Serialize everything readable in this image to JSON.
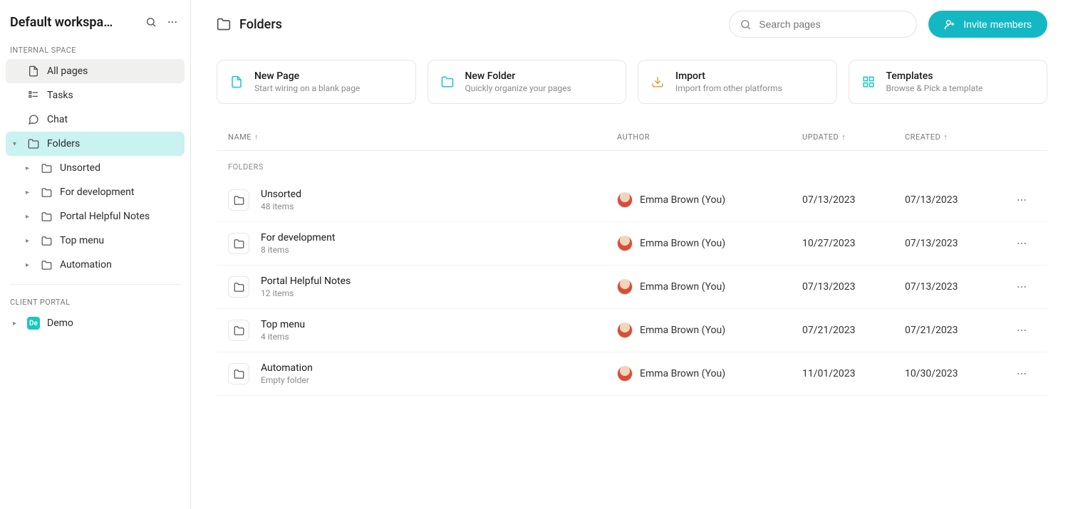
{
  "workspace": {
    "title": "Default workspa…"
  },
  "sidebar": {
    "sections": {
      "internal": {
        "label": "INTERNAL SPACE",
        "items": [
          {
            "label": "All pages"
          },
          {
            "label": "Tasks"
          },
          {
            "label": "Chat"
          },
          {
            "label": "Folders"
          }
        ],
        "folders": [
          {
            "label": "Unsorted"
          },
          {
            "label": "For development"
          },
          {
            "label": "Portal Helpful Notes"
          },
          {
            "label": "Top menu"
          },
          {
            "label": "Automation"
          }
        ]
      },
      "client": {
        "label": "CLIENT PORTAL",
        "items": [
          {
            "label": "Demo",
            "badge": "De"
          }
        ]
      }
    }
  },
  "header": {
    "title": "Folders",
    "search_placeholder": "Search pages",
    "invite_label": "Invite members"
  },
  "cards": [
    {
      "title": "New Page",
      "subtitle": "Start wiring on a blank page",
      "icon": "page",
      "color": "#18c7c1"
    },
    {
      "title": "New Folder",
      "subtitle": "Quickly organize your pages",
      "icon": "folder",
      "color": "#18c7c1"
    },
    {
      "title": "Import",
      "subtitle": "Import from other platforms",
      "icon": "download",
      "color": "#e0a03a"
    },
    {
      "title": "Templates",
      "subtitle": "Browse & Pick a template",
      "icon": "grid",
      "color": "#18c7c1"
    }
  ],
  "table": {
    "columns": {
      "name": "NAME",
      "author": "AUTHOR",
      "updated": "UPDATED",
      "created": "CREATED"
    },
    "group": "FOLDERS",
    "rows": [
      {
        "name": "Unsorted",
        "meta": "48 items",
        "author": "Emma Brown (You)",
        "updated": "07/13/2023",
        "created": "07/13/2023"
      },
      {
        "name": "For development",
        "meta": "8 items",
        "author": "Emma Brown (You)",
        "updated": "10/27/2023",
        "created": "07/13/2023"
      },
      {
        "name": "Portal Helpful Notes",
        "meta": "12 items",
        "author": "Emma Brown (You)",
        "updated": "07/13/2023",
        "created": "07/13/2023"
      },
      {
        "name": "Top menu",
        "meta": "4 items",
        "author": "Emma Brown (You)",
        "updated": "07/21/2023",
        "created": "07/21/2023"
      },
      {
        "name": "Automation",
        "meta": "Empty folder",
        "author": "Emma Brown (You)",
        "updated": "11/01/2023",
        "created": "10/30/2023"
      }
    ]
  }
}
